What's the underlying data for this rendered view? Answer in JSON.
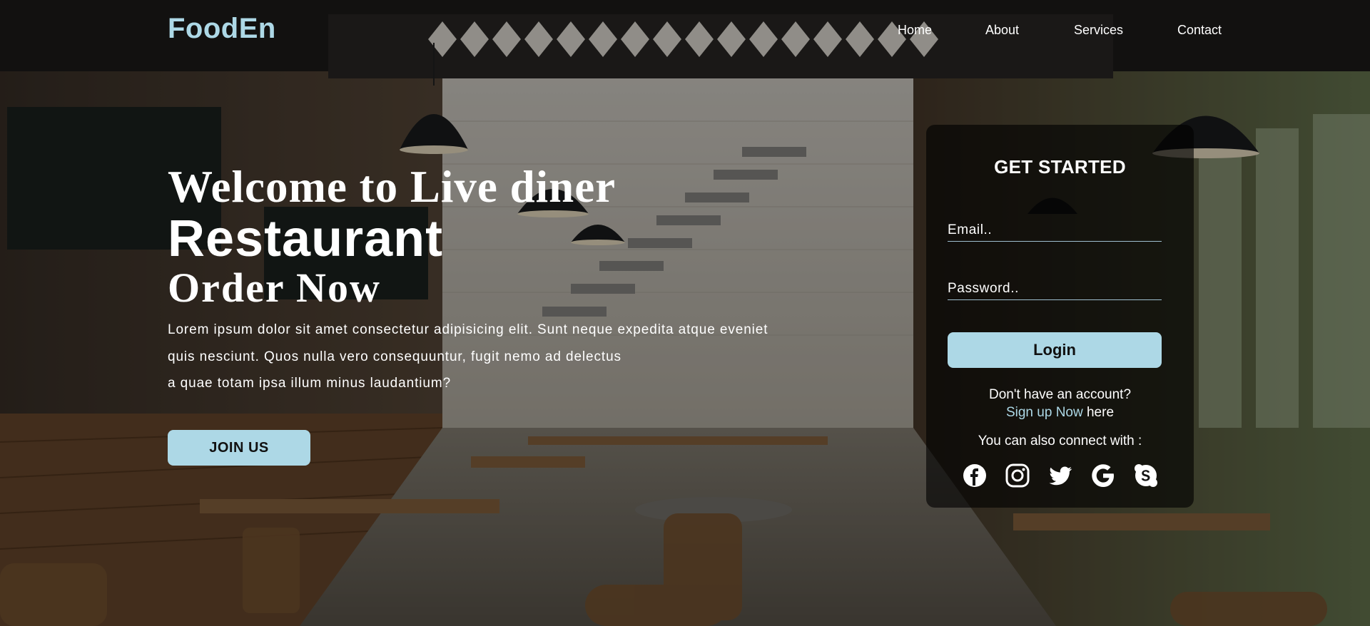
{
  "brand": {
    "logo": "FoodEn",
    "logo_color": "#add8e6"
  },
  "nav": {
    "items": [
      {
        "label": "Home"
      },
      {
        "label": "About"
      },
      {
        "label": "Services"
      },
      {
        "label": "Contact"
      }
    ]
  },
  "hero": {
    "line1": "Welcome to Live diner",
    "line2": "Restaurant",
    "line3": "Order Now",
    "description_lines": [
      "Lorem ipsum dolor sit amet consectetur adipisicing elit. Sunt neque expedita atque eveniet",
      "quis nesciunt. Quos nulla vero consequuntur, fugit nemo ad delectus",
      "a quae totam ipsa illum minus laudantium?"
    ],
    "cta_label": "JOIN US"
  },
  "login": {
    "title": "GET STARTED",
    "email_placeholder": "Email..",
    "password_placeholder": "Password..",
    "button_label": "Login",
    "no_account_text": "Don't have an account?",
    "signup_link": "Sign up Now",
    "signup_suffix": " here",
    "connect_text": "You can also connect with :",
    "socials": [
      "facebook-icon",
      "instagram-icon",
      "twitter-icon",
      "google-icon",
      "skype-icon"
    ]
  },
  "colors": {
    "accent": "#add8e6",
    "card_bg": "rgba(0,0,0,0.62)"
  }
}
